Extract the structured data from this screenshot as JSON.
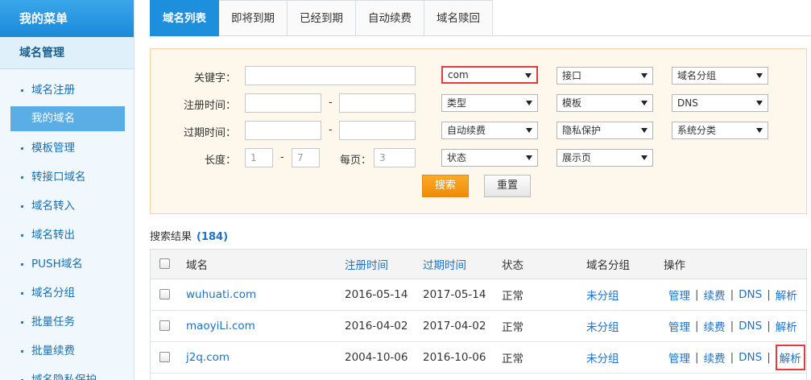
{
  "sidebar": {
    "header": "我的菜单",
    "section": "域名管理",
    "items": [
      {
        "label": "域名注册",
        "active": false
      },
      {
        "label": "我的域名",
        "active": true
      },
      {
        "label": "模板管理",
        "active": false
      },
      {
        "label": "转接口域名",
        "active": false
      },
      {
        "label": "域名转入",
        "active": false
      },
      {
        "label": "域名转出",
        "active": false
      },
      {
        "label": "PUSH域名",
        "active": false
      },
      {
        "label": "域名分组",
        "active": false
      },
      {
        "label": "批量任务",
        "active": false
      },
      {
        "label": "批量续费",
        "active": false
      },
      {
        "label": "域名隐私保护",
        "active": false
      }
    ]
  },
  "tabs": [
    {
      "label": "域名列表",
      "active": true
    },
    {
      "label": "即将到期",
      "active": false
    },
    {
      "label": "已经到期",
      "active": false
    },
    {
      "label": "自动续费",
      "active": false
    },
    {
      "label": "域名赎回",
      "active": false
    }
  ],
  "search": {
    "keyword_label": "关键字：",
    "reg_time_label": "注册时间：",
    "exp_time_label": "过期时间：",
    "length_label": "长度：",
    "length_min": "1",
    "length_max": "7",
    "page_label": "每页：",
    "page_size": "3",
    "dash": "-",
    "selects": {
      "suffix": "com",
      "interface": "接口",
      "group": "域名分组",
      "type": "类型",
      "template": "模板",
      "dns": "DNS",
      "auto_renew": "自动续费",
      "privacy": "隐私保护",
      "sys_category": "系统分类",
      "status": "状态",
      "display": "展示页"
    },
    "search_button": "搜索",
    "reset_button": "重置"
  },
  "results": {
    "title": "搜索结果",
    "count": "(184)",
    "columns": {
      "domain": "域名",
      "reg": "注册时间",
      "exp": "过期时间",
      "status": "状态",
      "group": "域名分组",
      "ops": "操作"
    },
    "rows": [
      {
        "domain": "wuhuati.com",
        "reg": "2016-05-14",
        "exp": "2017-05-14",
        "status": "正常",
        "group": "未分组"
      },
      {
        "domain": "maoyiLi.com",
        "reg": "2016-04-02",
        "exp": "2017-04-02",
        "status": "正常",
        "group": "未分组"
      },
      {
        "domain": "j2q.com",
        "reg": "2004-10-06",
        "exp": "2016-10-06",
        "status": "正常",
        "group": "未分组"
      }
    ],
    "ops": {
      "manage": "管理",
      "renew": "续费",
      "dns": "DNS",
      "resolve": "解析",
      "sep": "|"
    }
  },
  "colors": {
    "accent": "#1e8fdc",
    "link": "#1d72c8",
    "highlight": "#e23b3b",
    "search_btn": "#f08a05"
  }
}
